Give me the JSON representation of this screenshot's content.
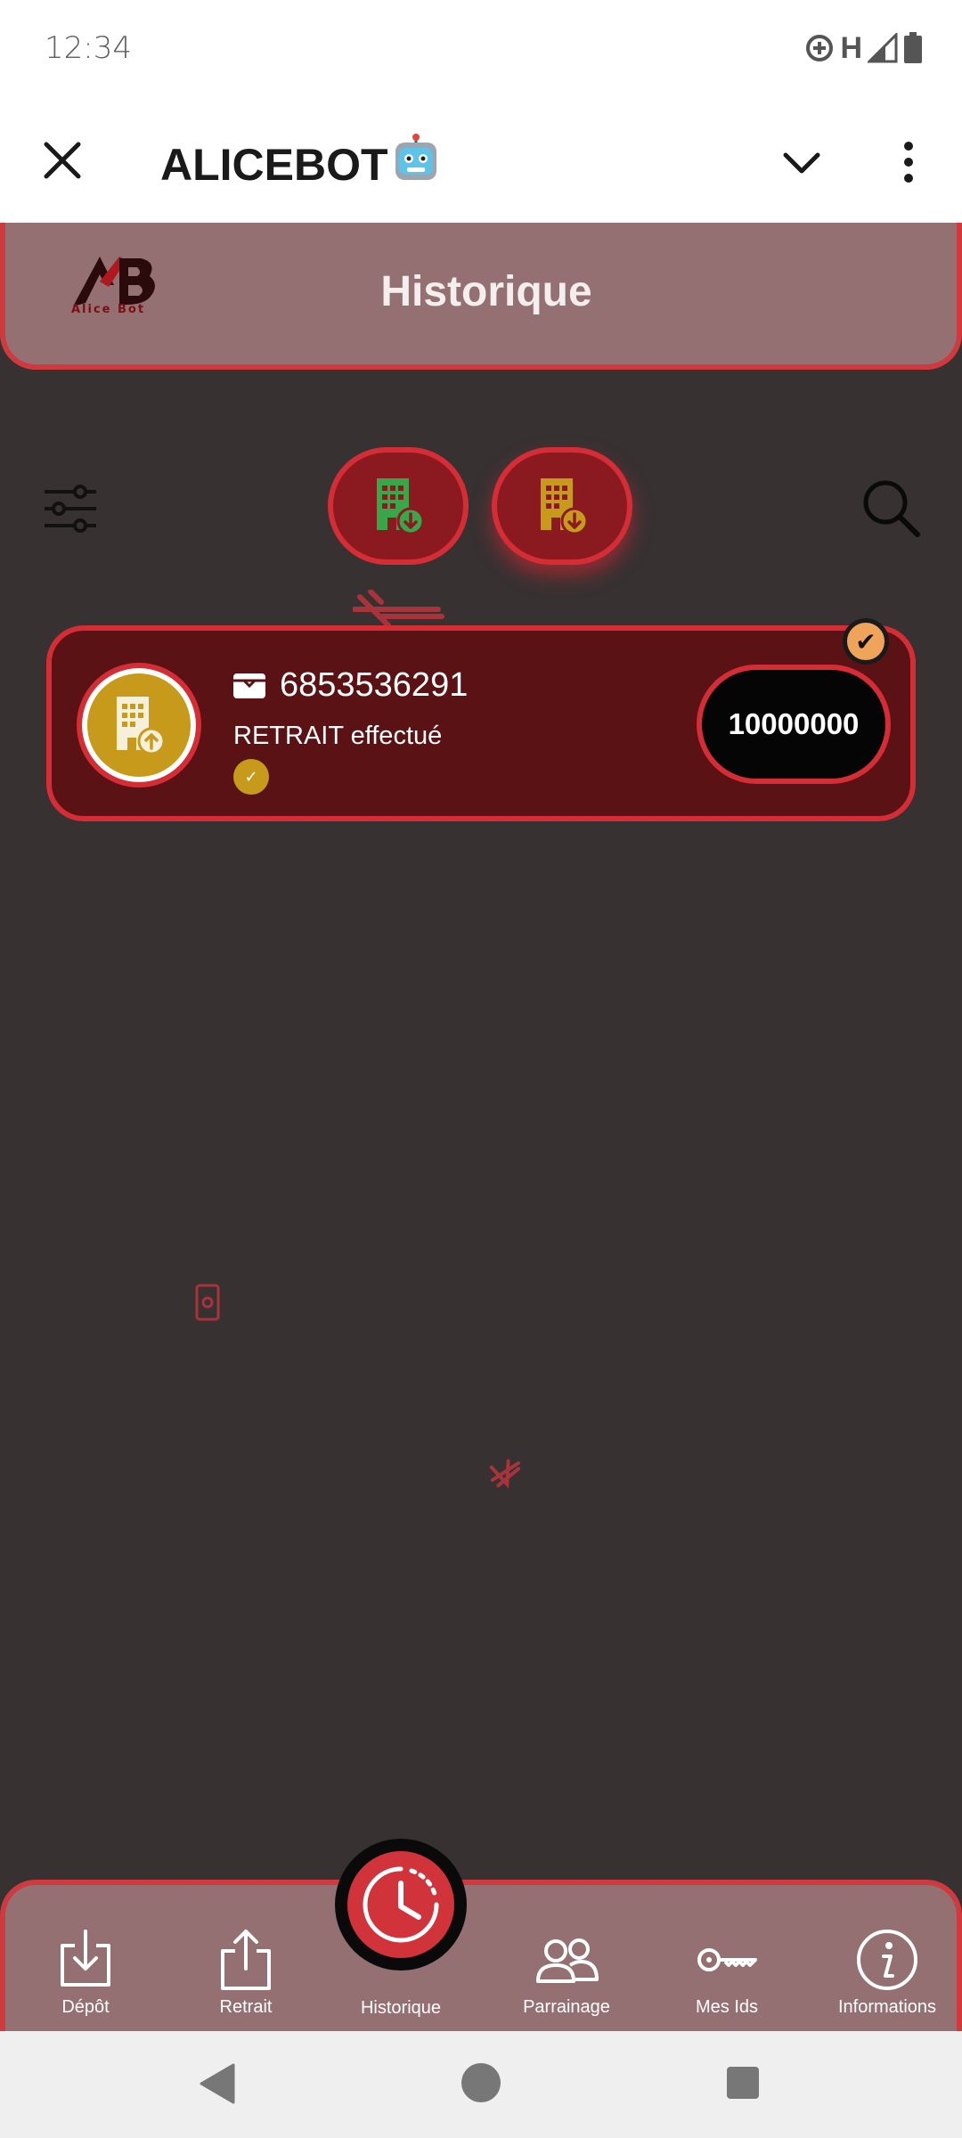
{
  "status_bar": {
    "time": "12:34",
    "network": "H",
    "icons": [
      "data-saver-icon",
      "network-h-icon",
      "signal-icon",
      "battery-icon"
    ]
  },
  "app_bar": {
    "title": "ALICEBOT",
    "title_emoji": "🤖",
    "icons": [
      "close-icon",
      "chevron-down-icon",
      "more-vert-icon"
    ]
  },
  "header": {
    "title": "Historique",
    "logo_text": "Alice Bot"
  },
  "toolbar": {
    "icons": [
      "filter-sliders-icon",
      "deposit-filter-icon",
      "withdraw-filter-icon",
      "search-icon"
    ]
  },
  "transactions": [
    {
      "id": "6853536291",
      "status": "RETRAIT effectué",
      "amount": "10000000",
      "icon": "building-upload-icon"
    }
  ],
  "bottom_nav": {
    "items": [
      {
        "label": "Dépôt",
        "icon": "download-tray-icon"
      },
      {
        "label": "Retrait",
        "icon": "upload-share-icon"
      },
      {
        "label": "Historique",
        "icon": "history-clock-icon"
      },
      {
        "label": "Parrainage",
        "icon": "people-icon"
      },
      {
        "label": "Mes Ids",
        "icon": "key-icon"
      },
      {
        "label": "Informations",
        "icon": "info-icon"
      }
    ]
  },
  "colors": {
    "background": "#373132",
    "header": "#957073",
    "accent_red": "#d42d35",
    "card": "#5b1214",
    "gold": "#c89a1b",
    "green": "#3aa64a"
  }
}
